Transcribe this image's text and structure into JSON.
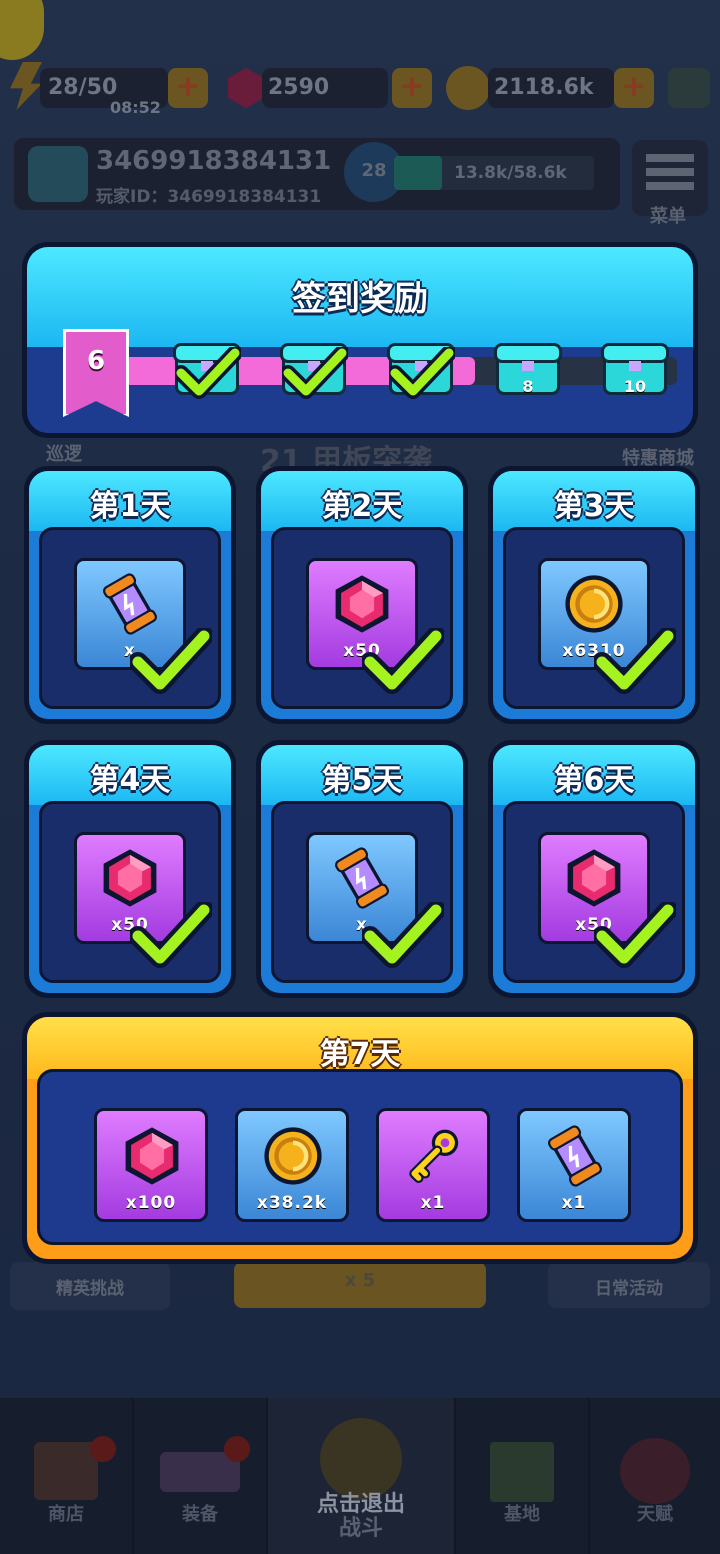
{
  "top_bar": {
    "energy": "28/50",
    "energy_timer": "08:52",
    "gems": "2590",
    "coins": "2118.6k"
  },
  "profile": {
    "name": "3469918384131",
    "player_id": "玩家ID：3469918384131",
    "level": "28",
    "xp": "13.8k/58.6k",
    "menu_label": "菜单"
  },
  "background_labels": {
    "patrol": "巡逻",
    "stage": "21 甲板突袭",
    "special_shop": "特惠商城",
    "elite": "精英挑战",
    "energy_cost": "x 5",
    "daily": "日常活动"
  },
  "bottom_nav": [
    {
      "label": "商店"
    },
    {
      "label": "装备"
    },
    {
      "label": "点击退出"
    },
    {
      "label": "战斗"
    },
    {
      "label": "基地"
    },
    {
      "label": "天赋"
    }
  ],
  "signin": {
    "title": "签到奖励",
    "progress_days": "6",
    "progress_fraction": 0.64,
    "milestones": [
      {
        "label": "",
        "claimed": true
      },
      {
        "label": "",
        "claimed": true
      },
      {
        "label": "",
        "claimed": true
      },
      {
        "label": "8",
        "claimed": false
      },
      {
        "label": "10",
        "claimed": false
      }
    ]
  },
  "days": [
    {
      "title": "第1天",
      "item": "energy-canister-icon",
      "count": "x",
      "tile": "blue",
      "claimed": true
    },
    {
      "title": "第2天",
      "item": "gem-icon",
      "count": "x50",
      "tile": "purple",
      "claimed": true
    },
    {
      "title": "第3天",
      "item": "coin-icon",
      "count": "x6310",
      "tile": "blue",
      "claimed": true
    },
    {
      "title": "第4天",
      "item": "gem-icon",
      "count": "x50",
      "tile": "purple",
      "claimed": true
    },
    {
      "title": "第5天",
      "item": "energy-canister-icon",
      "count": "x",
      "tile": "blue",
      "claimed": true
    },
    {
      "title": "第6天",
      "item": "gem-icon",
      "count": "x50",
      "tile": "purple",
      "claimed": true
    }
  ],
  "day7": {
    "title": "第7天",
    "rewards": [
      {
        "item": "gem-icon",
        "count": "x100",
        "tile": "purple"
      },
      {
        "item": "coin-icon",
        "count": "x38.2k",
        "tile": "blue"
      },
      {
        "item": "key-icon",
        "count": "x1",
        "tile": "purple"
      },
      {
        "item": "energy-canister-icon",
        "count": "x1",
        "tile": "blue"
      }
    ]
  },
  "colors": {
    "check": "#a4f21e",
    "gem": "#e82a6e",
    "coin": "#f5b21c",
    "canister": "#f08a1e"
  }
}
